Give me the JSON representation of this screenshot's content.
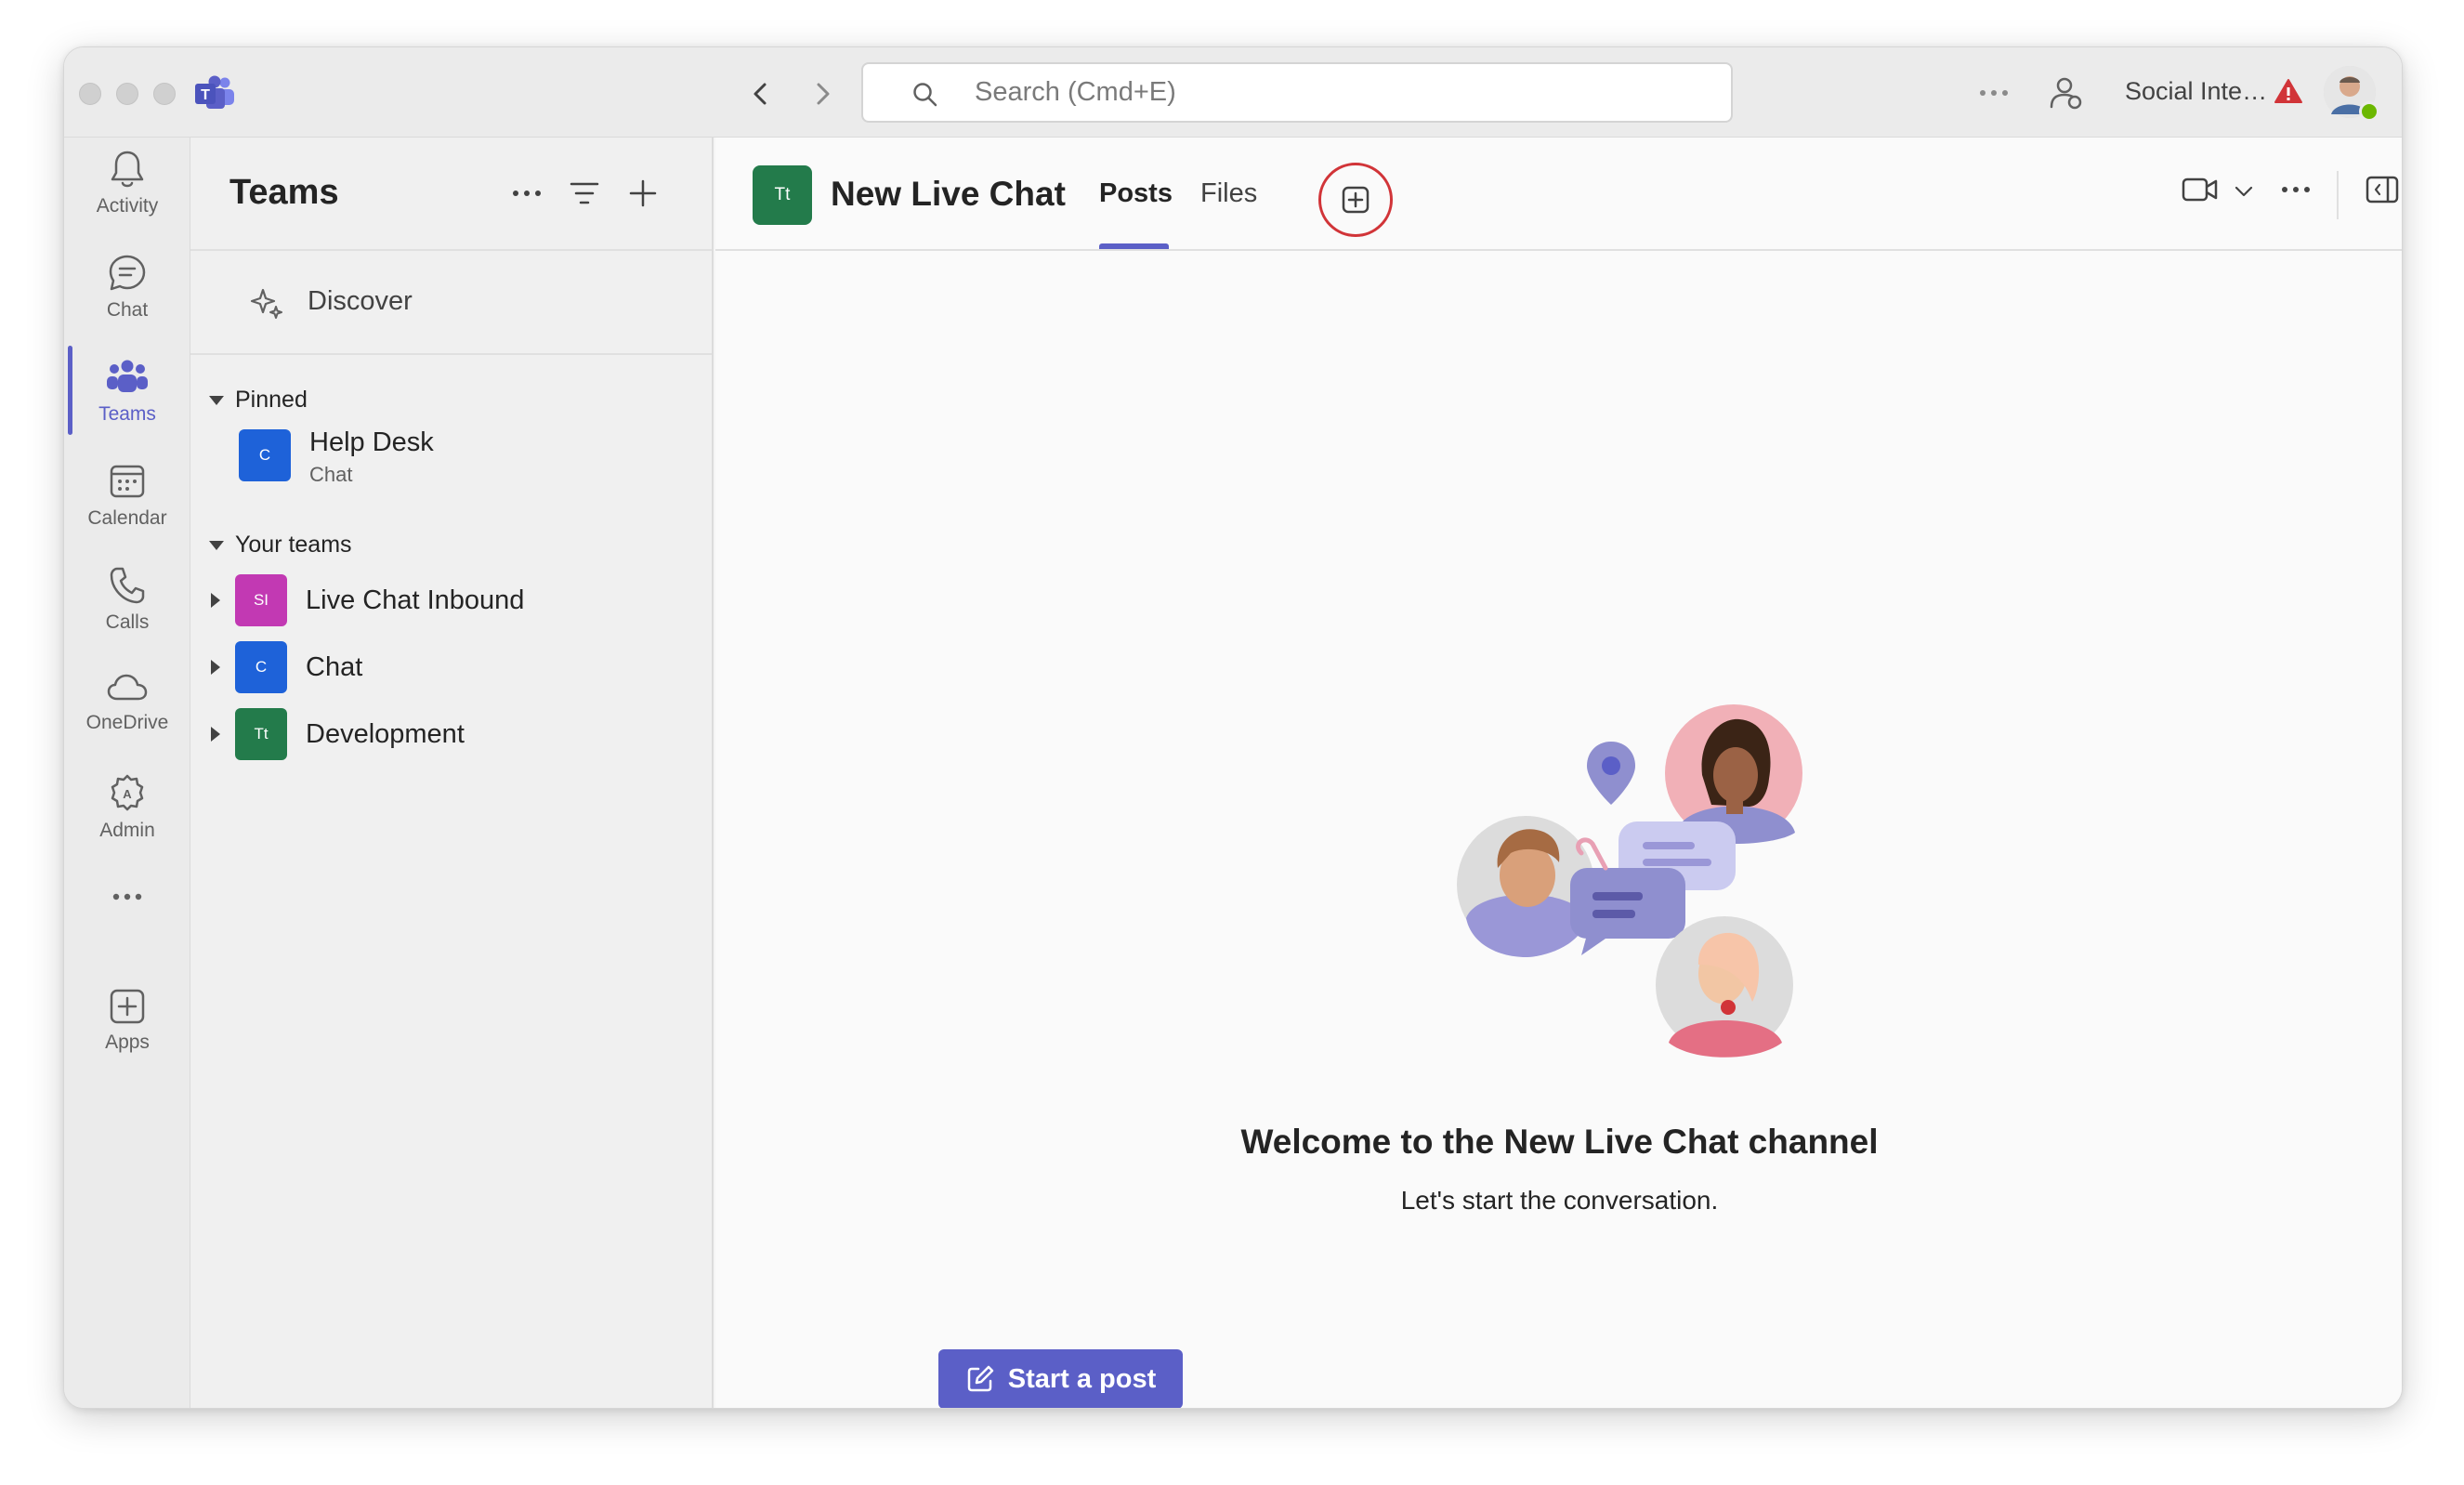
{
  "titlebar": {
    "search_placeholder": "Search (Cmd+E)",
    "org_name": "Social Inte…",
    "icons": [
      "teams-logo-icon",
      "back-arrow-icon",
      "forward-arrow-icon",
      "search-icon",
      "more-icon",
      "people-settings-icon",
      "warning-icon"
    ]
  },
  "rail": {
    "items": [
      {
        "label": "Activity",
        "icon": "bell-icon"
      },
      {
        "label": "Chat",
        "icon": "chat-icon"
      },
      {
        "label": "Teams",
        "icon": "teams-icon",
        "active": true
      },
      {
        "label": "Calendar",
        "icon": "calendar-icon"
      },
      {
        "label": "Calls",
        "icon": "phone-icon"
      },
      {
        "label": "OneDrive",
        "icon": "cloud-icon"
      },
      {
        "label": "Admin",
        "icon": "admin-icon"
      },
      {
        "label": "Apps",
        "icon": "apps-icon"
      }
    ]
  },
  "panel": {
    "title": "Teams",
    "discover_label": "Discover",
    "pinned_label": "Pinned",
    "pinned": [
      {
        "name": "Help Desk",
        "sub": "Chat",
        "initials": "C",
        "color": "#1e62d9"
      }
    ],
    "your_teams_label": "Your teams",
    "teams": [
      {
        "name": "Live Chat Inbound",
        "initials": "SI",
        "color": "#c239b3"
      },
      {
        "name": "Chat",
        "initials": "C",
        "color": "#1e62d9"
      },
      {
        "name": "Development",
        "initials": "Tt",
        "color": "#237b4b"
      }
    ]
  },
  "main": {
    "channel_initials": "Tt",
    "channel_color": "#237b4b",
    "channel_title": "New Live Chat",
    "tabs": [
      {
        "label": "Posts",
        "active": true
      },
      {
        "label": "Files",
        "active": false
      }
    ],
    "welcome_title": "Welcome to the New Live Chat channel",
    "welcome_sub": "Let's start the conversation.",
    "start_post_label": "Start a post"
  },
  "colors": {
    "accent": "#5b5fc7",
    "highlight_ring": "#d13438",
    "status_available": "#6bb700"
  }
}
